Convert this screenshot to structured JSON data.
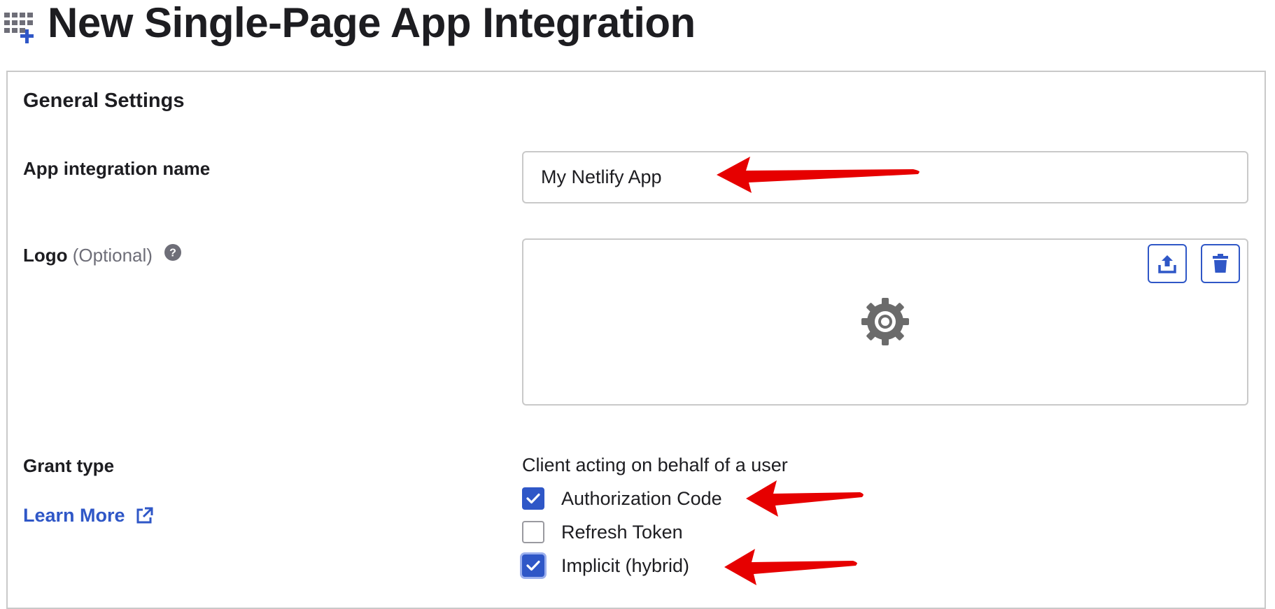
{
  "header": {
    "title": "New Single-Page App Integration",
    "icon": "app-grid-add-icon"
  },
  "general_settings": {
    "title": "General Settings",
    "app_name": {
      "label": "App integration name",
      "value": "My Netlify App"
    },
    "logo": {
      "label": "Logo",
      "optional": "(Optional)",
      "help_icon": "question-circle-icon",
      "placeholder_icon": "gear-icon",
      "upload_icon": "upload-icon",
      "delete_icon": "trash-icon"
    },
    "grant_type": {
      "label": "Grant type",
      "learn_more": "Learn More",
      "learn_more_icon": "external-link-icon",
      "heading": "Client acting on behalf of a user",
      "options": [
        {
          "label": "Authorization Code",
          "checked": true
        },
        {
          "label": "Refresh Token",
          "checked": false
        },
        {
          "label": "Implicit (hybrid)",
          "checked": true
        }
      ]
    }
  },
  "annotations": {
    "arrow_color": "#e60000",
    "count": 3
  },
  "colors": {
    "accent": "#2f57c7",
    "border": "#c9c9c9",
    "text": "#1d1d21"
  }
}
